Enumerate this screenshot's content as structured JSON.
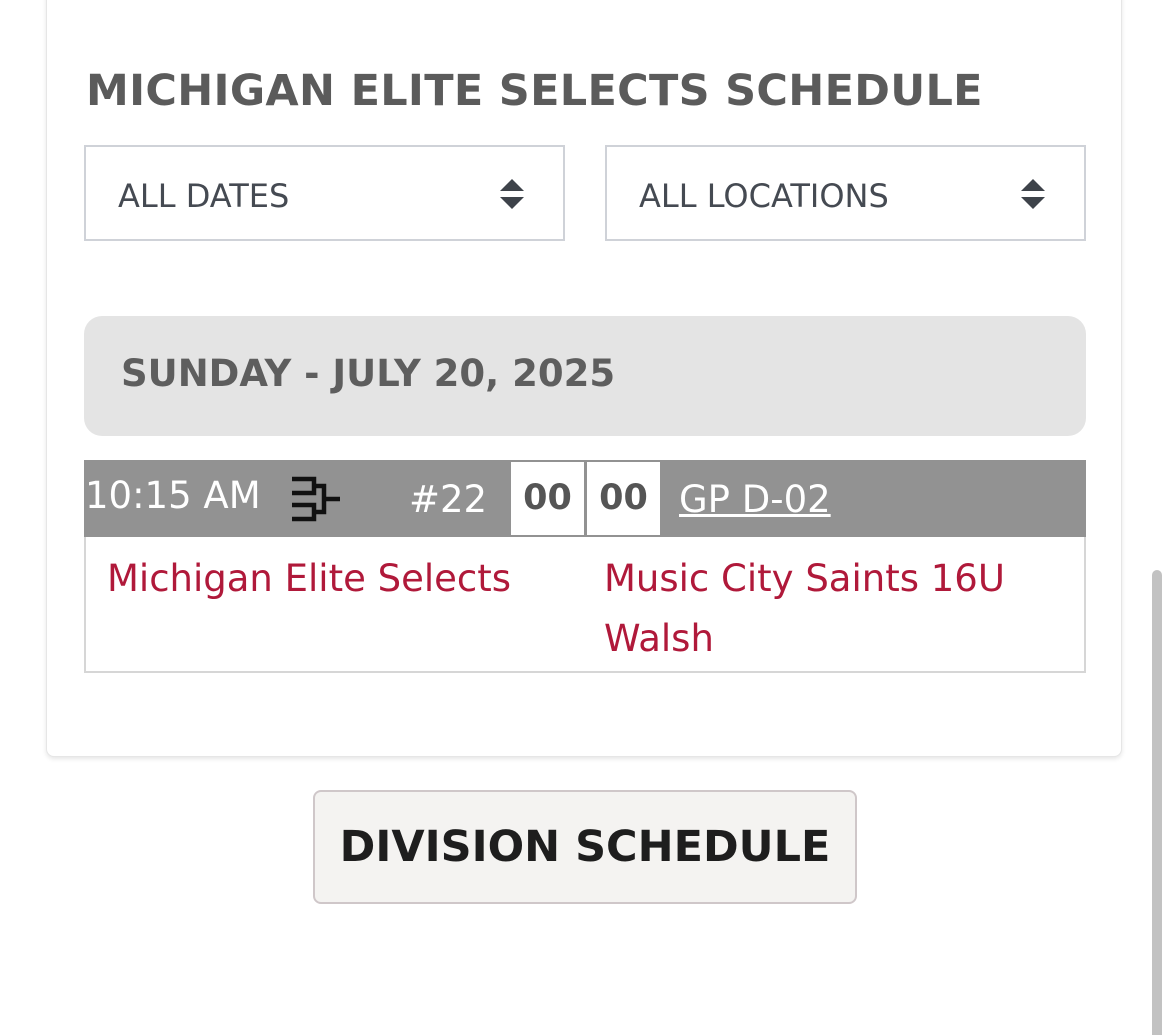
{
  "schedule": {
    "title": "MICHIGAN ELITE SELECTS SCHEDULE"
  },
  "filters": {
    "dates_selected": "ALL DATES",
    "locations_selected": "ALL LOCATIONS"
  },
  "day": {
    "label": "SUNDAY - JULY 20, 2025"
  },
  "game": {
    "time": "10:15 AM",
    "icon": "bracket-icon",
    "number": "#22",
    "home_score": "00",
    "away_score": "00",
    "field": "GP D-02",
    "home_team": "Michigan Elite Selects",
    "away_team": "Music City Saints 16U Walsh"
  },
  "actions": {
    "division_schedule": "DIVISION SCHEDULE"
  },
  "colors": {
    "title": "#5b5b5b",
    "team_link": "#b0193a",
    "game_bar": "#929292",
    "date_header": "#e4e4e4"
  }
}
